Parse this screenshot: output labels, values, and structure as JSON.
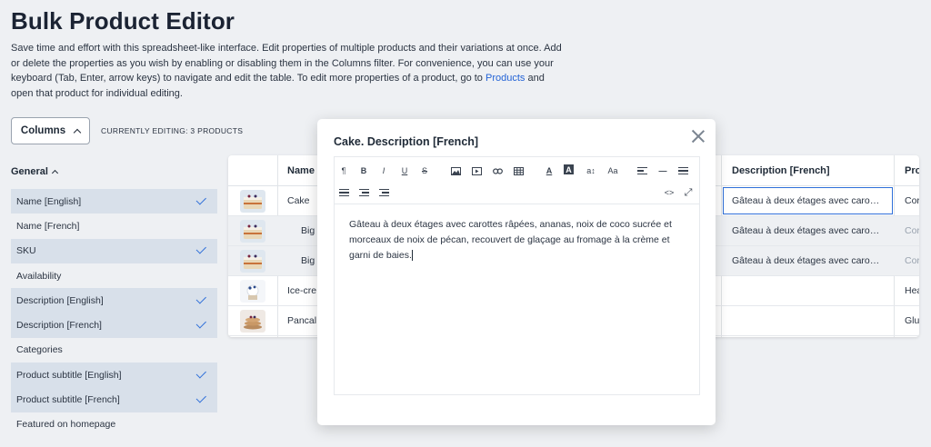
{
  "page": {
    "title": "Bulk Product Editor",
    "intro_before_link": "Save time and effort with this spreadsheet-like interface. Edit properties of multiple products and their variations at once. Add or delete the properties as you wish by enabling or disabling them in the Columns filter. For convenience, you can use your keyboard (Tab, Enter, arrow keys) to navigate and edit the table. To edit more properties of a product, go to ",
    "intro_link": "Products",
    "intro_after_link": " and open that product for individual editing."
  },
  "controls": {
    "columns_label": "Columns",
    "editing_status": "CURRENTLY EDITING: 3 PRODUCTS"
  },
  "sidebar": {
    "group_label": "General",
    "items": [
      {
        "label": "Name [English]",
        "checked": true
      },
      {
        "label": "Name [French]",
        "checked": false
      },
      {
        "label": "SKU",
        "checked": true
      },
      {
        "label": "Availability",
        "checked": false
      },
      {
        "label": "Description [English]",
        "checked": true
      },
      {
        "label": "Description [French]",
        "checked": true
      },
      {
        "label": "Categories",
        "checked": false
      },
      {
        "label": "Product subtitle [English]",
        "checked": true
      },
      {
        "label": "Product subtitle [French]",
        "checked": true
      },
      {
        "label": "Featured on homepage",
        "checked": false
      }
    ]
  },
  "table": {
    "headers": {
      "name": "Name",
      "description_fr": "Description [French]",
      "product_subtitle": "Pro"
    },
    "rows": [
      {
        "name": "Cake",
        "description_fr": "Gâteau à deux étages avec caro…",
        "subtitle": "Cor",
        "subtitle_muted": false
      },
      {
        "name": "Big",
        "description_fr": "Gâteau à deux étages avec caro…",
        "subtitle": "Cor",
        "subtitle_muted": true
      },
      {
        "name": "Big",
        "description_fr": "Gâteau à deux étages avec caro…",
        "subtitle": "Cor",
        "subtitle_muted": true
      },
      {
        "name": "Ice-cre",
        "description_fr": "",
        "subtitle": "Hea",
        "subtitle_muted": false
      },
      {
        "name": "Pancal",
        "description_fr": "",
        "subtitle": "Glu",
        "subtitle_muted": false
      }
    ]
  },
  "modal": {
    "title": "Cake. Description [French]",
    "toolbar": {
      "paragraph": "¶",
      "bold": "B",
      "italic": "I",
      "underline": "U",
      "strike": "S",
      "text_color": "A",
      "bg_color": "A",
      "line_height": "a↕",
      "font_case": "Aa",
      "horizontal_rule": "—",
      "code_view": "<>",
      "fullscreen": "⤢"
    },
    "content": "Gâteau à deux étages avec carottes râpées, ananas, noix de coco sucrée et morceaux de noix de pécan, recouvert de glaçage au fromage à la crème et garni de baies."
  },
  "colors": {
    "accent": "#2f6fd9",
    "link": "#2463d6",
    "selected_row": "#d8e0ea",
    "background": "#eef0f3"
  }
}
